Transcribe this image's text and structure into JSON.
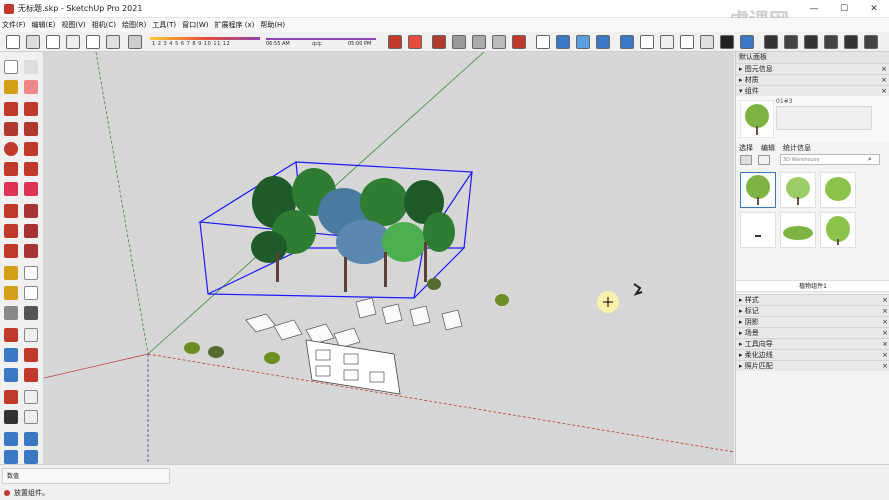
{
  "window": {
    "title": "无标题.skp - SketchUp Pro 2021",
    "watermark": "虎课网"
  },
  "menu": [
    "文件(F)",
    "编辑(E)",
    "视图(V)",
    "相机(C)",
    "绘图(R)",
    "工具(T)",
    "窗口(W)",
    "扩展程序 (x)",
    "帮助(H)"
  ],
  "shadow": {
    "months": "1 2 3 4 5 6 7 8 9 10 11 12",
    "time_start": "06:55 AM",
    "time_mid": "中午",
    "time_end": "05:00 PM"
  },
  "tray": {
    "header": "默认面板",
    "rows_top": [
      "▸ 图元信息",
      "▸ 材质",
      "▾ 组件"
    ],
    "component_name": "01#3",
    "tabs": [
      "选择",
      "编辑",
      "统计信息"
    ],
    "search_placeholder": "3D Warehouse",
    "selected_caption": "植物组件1",
    "rows_bottom": [
      "▸ 样式",
      "▸ 标记",
      "▸ 阴影",
      "▸ 场景",
      "▸ 工具向导",
      "▸ 柔化边线",
      "▸ 照片匹配"
    ]
  },
  "measurement": {
    "label": "数值"
  },
  "status": {
    "text": "放置组件。"
  },
  "colors": {
    "accent": "#3a78c4",
    "selection": "#1a1aff",
    "tree_dark": "#1e5a2a",
    "tree_light": "#4caf50"
  }
}
